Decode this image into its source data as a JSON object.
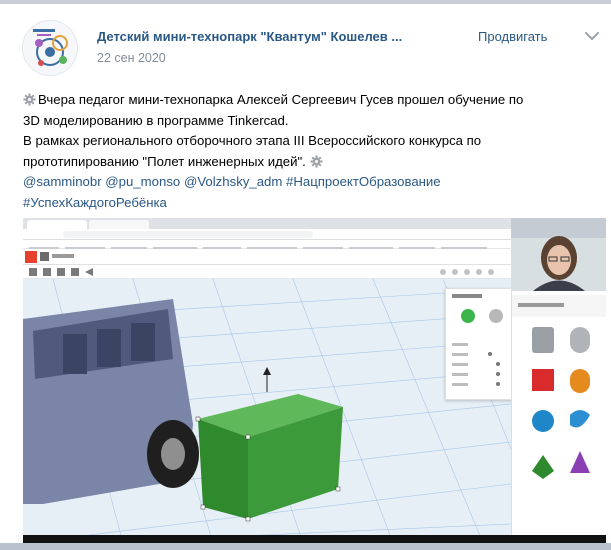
{
  "post": {
    "group_name": "Детский мини-технопарк \"Квантум\" Кошелев ...",
    "date": "22 сен 2020",
    "promote_label": "Продвигать",
    "text": {
      "line1": "Вчера педагог мини-технопарка Алексей Сергеевич Гусев прошел обучение по",
      "line2": "3D моделированию в программе Tinkercad.",
      "line3": "В рамках регионального отборочного этапа III Всероссийского конкурса по",
      "line4": "прототипированию \"Полет инженерных идей\".",
      "hashtags": {
        "tag1": "@samminobr",
        "tag2": "@pu_monso",
        "tag3": "@Volzhsky_adm",
        "tag4": "#НацпроектОбразование",
        "tag5": "#УспехКаждогоРебёнка"
      }
    },
    "icons": {
      "avatar": "group-logo",
      "menu": "chevron-down-icon",
      "emoji": "gear-emoji-icon"
    }
  },
  "colors": {
    "link": "#2a5885",
    "meta": "#818c99",
    "green_box": "#3c9a3a",
    "tinkercad_red": "#e5412d"
  }
}
